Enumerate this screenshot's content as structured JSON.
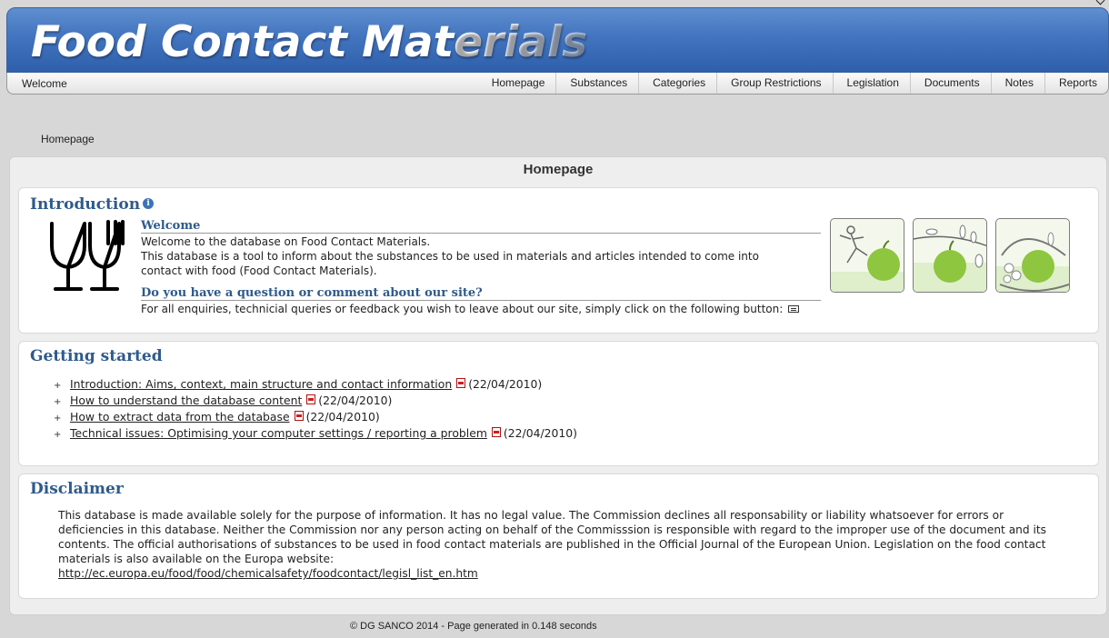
{
  "header": {
    "title_main": "Food Contact Mat",
    "title_fade": "erials"
  },
  "nav": {
    "welcome": "Welcome",
    "items": [
      "Homepage",
      "Substances",
      "Categories",
      "Group Restrictions",
      "Legislation",
      "Documents",
      "Notes",
      "Reports"
    ]
  },
  "breadcrumb": "Homepage",
  "main": {
    "title": "Homepage",
    "intro": {
      "heading": "Introduction",
      "info_icon": "i",
      "welcome_heading": "Welcome",
      "welcome_line1": "Welcome to the database on Food Contact Materials.",
      "welcome_line2": "This database is a tool to inform about the substances to be used in materials and articles intended to come into contact with food (Food Contact Materials).",
      "question_heading": "Do you have a question or comment about our site?",
      "question_text": "For all enquiries, technicial queries or feedback you wish to leave about our site, simply click on the following button:",
      "icons": [
        "glass-fork-icon",
        "mail-icon",
        "apple-runner-image",
        "apple-branch-image",
        "apple-basket-image"
      ]
    },
    "getting_started": {
      "heading": "Getting started",
      "bullet": "+",
      "items": [
        {
          "label": "Introduction: Aims, context, main structure and contact information",
          "date": "(22/04/2010)"
        },
        {
          "label": "How to understand the database content",
          "date": "(22/04/2010)"
        },
        {
          "label": "How to extract data from the database",
          "date": "(22/04/2010)"
        },
        {
          "label": "Technical issues: Optimising your computer settings / reporting a problem",
          "date": "(22/04/2010)"
        }
      ]
    },
    "disclaimer": {
      "heading": "Disclaimer",
      "text": "This database is made available solely for the purpose of information. It has no legal value. The Commission declines all responsability or liability whatsoever for errors or deficiencies in this database. Neither the Commission nor any person acting on behalf of the Commisssion is responsible with regard to the improper use of the document and its contents. The official authorisations of substances to be used in food contact materials are published in the Official Journal of the European Union. Legislation on the food contact materials is also available on the Europa website:",
      "link": "http://ec.europa.eu/food/food/chemicalsafety/foodcontact/legisl_list_en.htm"
    }
  },
  "footer": "© DG SANCO 2014 - Page generated in 0.148 seconds",
  "colors": {
    "banner": "#4274bf",
    "heading": "#2e5a8c",
    "background": "#d7d7d7",
    "apple_green": "#8ec63f"
  }
}
